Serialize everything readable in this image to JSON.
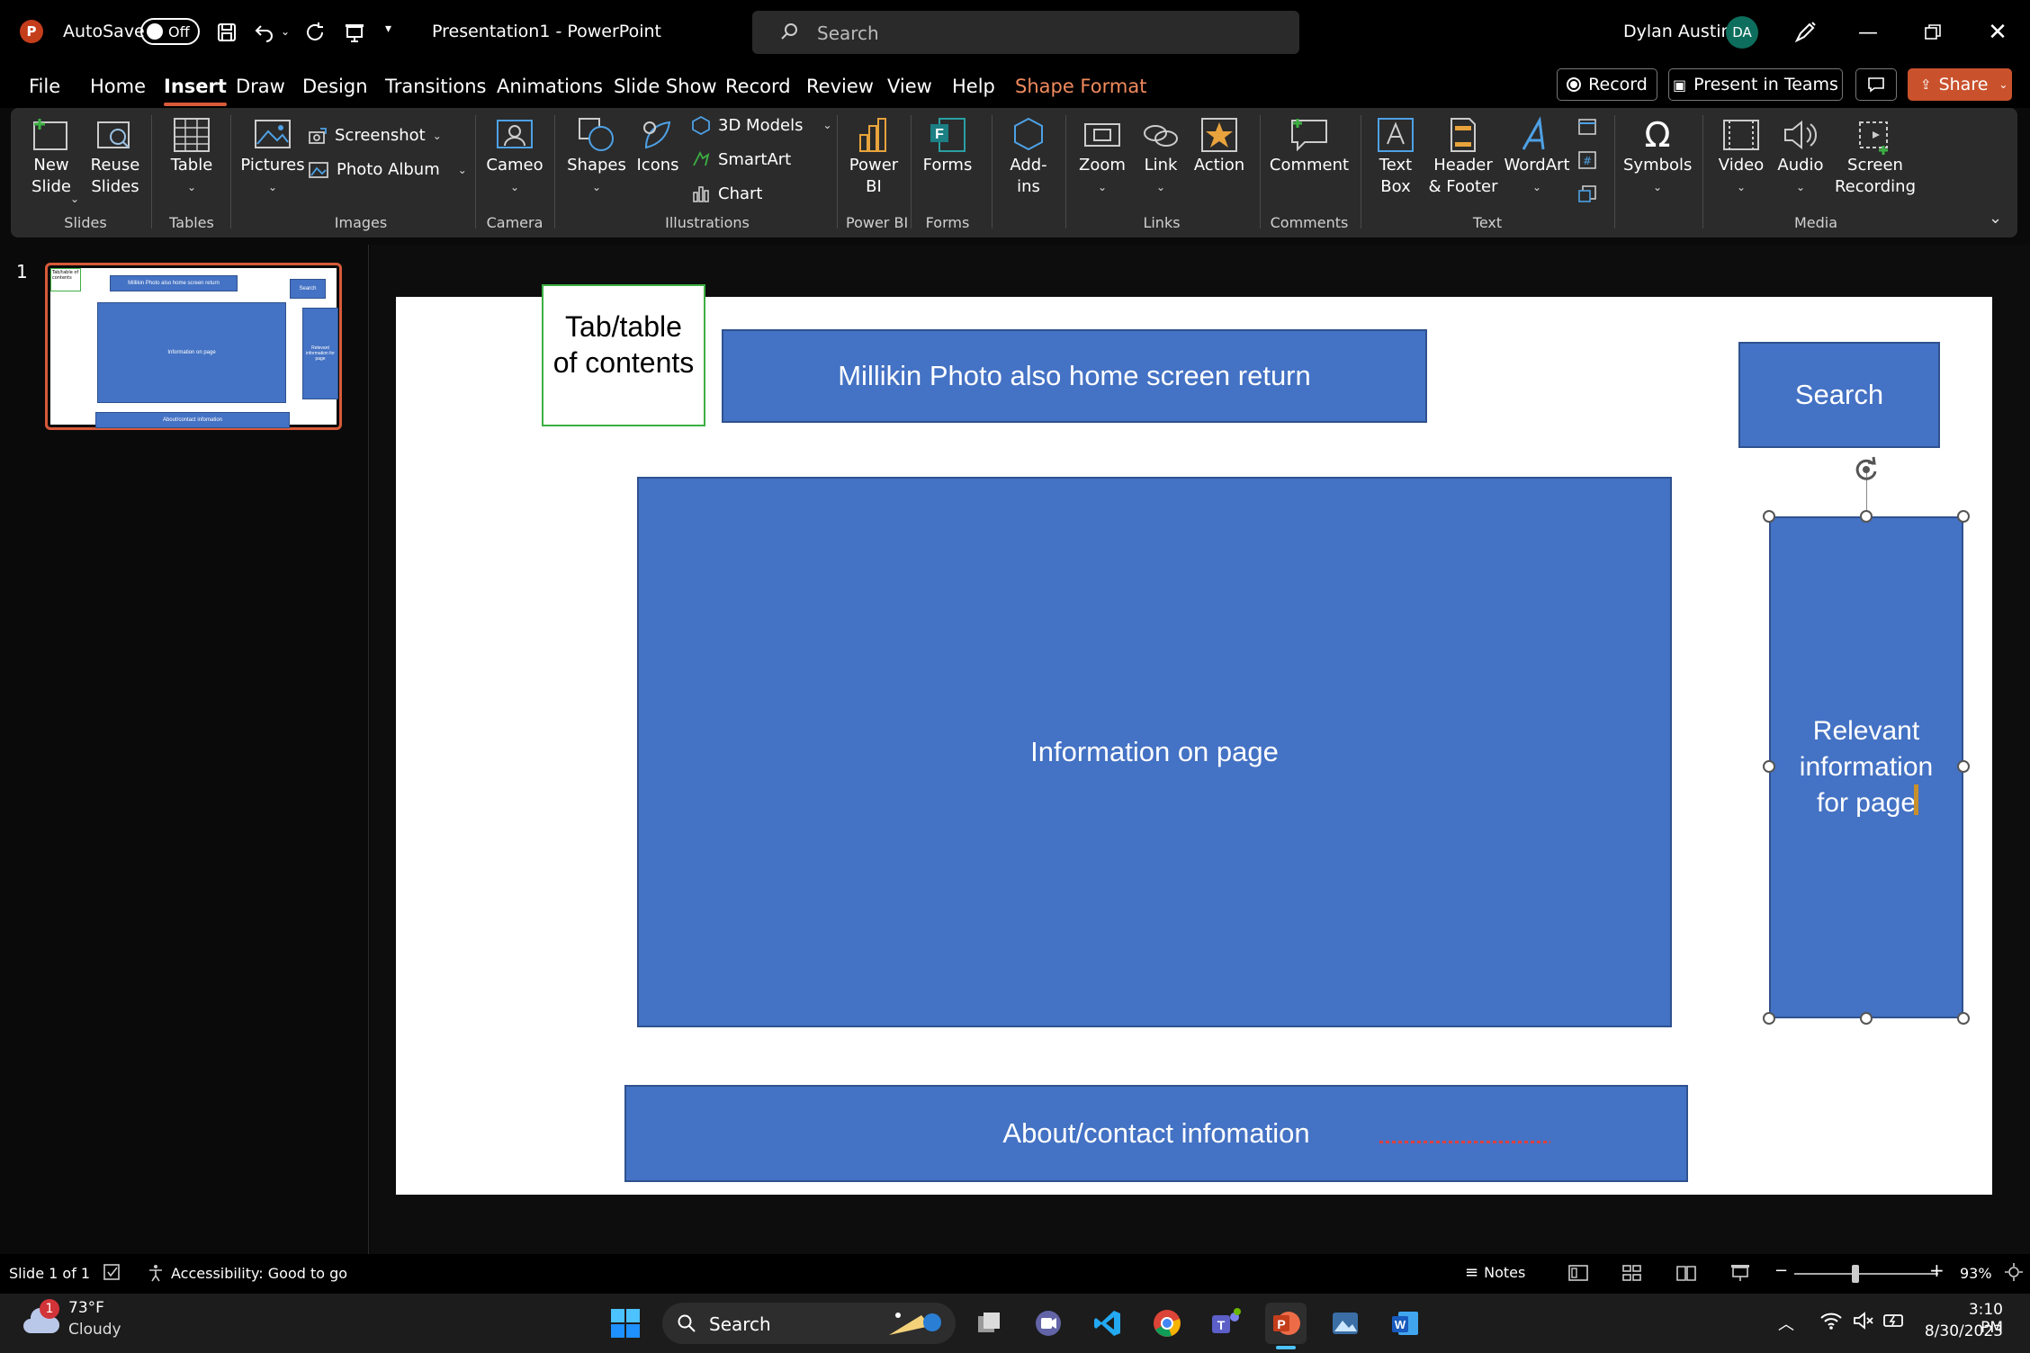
{
  "titlebar": {
    "autosave_label": "AutoSave",
    "autosave_state": "Off",
    "document_title": "Presentation1  -  PowerPoint",
    "search_placeholder": "Search",
    "user_name": "Dylan Austin",
    "user_initials": "DA"
  },
  "tabs": [
    "File",
    "Home",
    "Insert",
    "Draw",
    "Design",
    "Transitions",
    "Animations",
    "Slide Show",
    "Record",
    "Review",
    "View",
    "Help",
    "Shape Format"
  ],
  "tab_actions": {
    "record": "Record",
    "present": "Present in Teams",
    "share": "Share"
  },
  "ribbon": {
    "new_slide": "New\nSlide",
    "reuse_slides": "Reuse\nSlides",
    "table": "Table",
    "pictures": "Pictures",
    "screenshot": "Screenshot",
    "photo_album": "Photo Album",
    "cameo": "Cameo",
    "shapes": "Shapes",
    "icons": "Icons",
    "models_3d": "3D Models",
    "smartart": "SmartArt",
    "chart": "Chart",
    "power_bi": "Power\nBI",
    "forms": "Forms",
    "addins": "Add-\nins",
    "zoom": "Zoom",
    "link": "Link",
    "action": "Action",
    "comment": "Comment",
    "text_box": "Text\nBox",
    "header_footer": "Header\n& Footer",
    "wordart": "WordArt",
    "symbols": "Symbols",
    "video": "Video",
    "audio": "Audio",
    "screen_recording": "Screen\nRecording",
    "groups": {
      "slides": "Slides",
      "tables": "Tables",
      "images": "Images",
      "camera": "Camera",
      "illustrations": "Illustrations",
      "powerbi": "Power BI",
      "forms": "Forms",
      "links": "Links",
      "comments": "Comments",
      "text": "Text",
      "media": "Media"
    }
  },
  "thumbnail": {
    "number": "1",
    "toc": "Tab/table of contents",
    "header": "Millikin Photo also home screen return",
    "search": "Search",
    "info": "Information on page",
    "relevant": "Relevant information for page",
    "about": "About/contact infomation"
  },
  "slide": {
    "toc_text": "Tab/table\nof contents",
    "header_text": "Millikin Photo also home screen return",
    "search_text": "Search",
    "info_text": "Information on page",
    "relevant_text": "Relevant\ninformation\nfor page",
    "about_text": "About/contact infomation"
  },
  "status": {
    "slide_count": "Slide 1 of 1",
    "accessibility": "Accessibility: Good to go",
    "notes": "Notes",
    "zoom": "93%"
  },
  "taskbar": {
    "weather_temp": "73°F",
    "weather_desc": "Cloudy",
    "weather_badge": "1",
    "search": "Search",
    "time": "3:10 PM",
    "date": "8/30/2023"
  },
  "colors": {
    "accent": "#d85a3a",
    "shape_fill": "#4472c4",
    "share": "#c9522d"
  }
}
